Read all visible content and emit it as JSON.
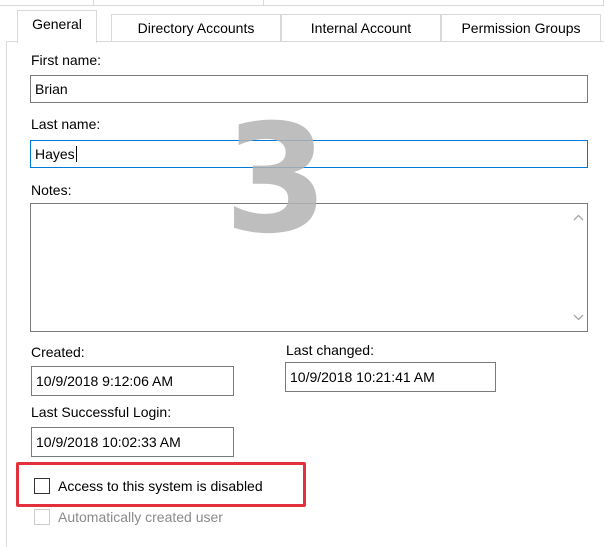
{
  "tabs": [
    {
      "label": "General",
      "active": true
    },
    {
      "label": "Directory Accounts",
      "active": false
    },
    {
      "label": "Internal Account",
      "active": false
    },
    {
      "label": "Permission Groups",
      "active": false
    }
  ],
  "fields": {
    "first_name_label": "First name:",
    "first_name_value": "Brian",
    "last_name_label": "Last name:",
    "last_name_value": "Hayes",
    "notes_label": "Notes:",
    "notes_value": "",
    "created_label": "Created:",
    "created_value": "10/9/2018 9:12:06 AM",
    "last_changed_label": "Last changed:",
    "last_changed_value": "10/9/2018 10:21:41 AM",
    "last_login_label": "Last Successful Login:",
    "last_login_value": "10/9/2018 10:02:33 AM"
  },
  "checkboxes": {
    "access_disabled_label": "Access to this system is disabled",
    "access_disabled_checked": false,
    "auto_created_label": "Automatically created user",
    "auto_created_checked": false,
    "auto_created_enabled": false
  },
  "watermark_number": "3",
  "colors": {
    "highlight": "#e3313b",
    "focus_border": "#0078d7",
    "watermark": "#b3b3b3"
  },
  "icons": {
    "scroll_up": "chevron-up-icon",
    "scroll_down": "chevron-down-icon"
  }
}
